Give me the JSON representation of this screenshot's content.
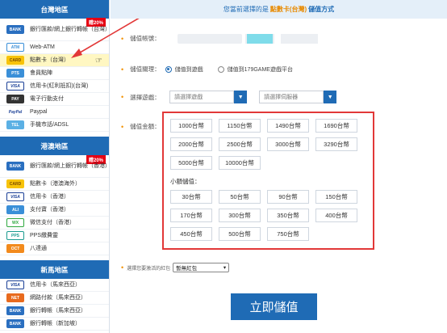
{
  "sidebar": {
    "taiwan": {
      "header": "台灣地區",
      "promo": "贈20%",
      "items": [
        {
          "label": "銀行匯款/網上銀行轉帳（台灣）",
          "icon": "bank-icon",
          "icon_text": "BANK"
        },
        {
          "label": "Web-ATM",
          "icon": "webatm-icon",
          "icon_text": "ATM"
        },
        {
          "label": "點數卡（台灣）",
          "icon": "point-card-icon",
          "icon_text": "CARD"
        },
        {
          "label": "會員點陣",
          "icon": "member-points-icon",
          "icon_text": "PTS"
        },
        {
          "label": "信用卡(紅利抵扣)(台灣)",
          "icon": "visa-icon",
          "icon_text": "VISA"
        },
        {
          "label": "電子行動支付",
          "icon": "mobile-pay-icon",
          "icon_text": "PAY"
        },
        {
          "label": "Paypal",
          "icon": "paypal-icon",
          "icon_text": "PayPal"
        },
        {
          "label": "手機市話/ADSL",
          "icon": "phone-adsl-icon",
          "icon_text": "TEL"
        }
      ]
    },
    "hongkong": {
      "header": "港澳地區",
      "promo": "贈20%",
      "items": [
        {
          "label": "銀行匯款/網上銀行轉帳（香港）",
          "icon": "bank-icon",
          "icon_text": "BANK"
        },
        {
          "label": "點數卡（港澳海外）",
          "icon": "point-card-icon",
          "icon_text": "CARD"
        },
        {
          "label": "信用卡（香港）",
          "icon": "visa-icon",
          "icon_text": "VISA"
        },
        {
          "label": "支付寶（香港）",
          "icon": "alipay-icon",
          "icon_text": "ALI"
        },
        {
          "label": "微信支付（香港）",
          "icon": "wechat-pay-icon",
          "icon_text": "WX"
        },
        {
          "label": "PPS繳費靈",
          "icon": "pps-icon",
          "icon_text": "PPS"
        },
        {
          "label": "八達通",
          "icon": "octopus-icon",
          "icon_text": "OCT"
        }
      ]
    },
    "singapore": {
      "header": "新馬地區",
      "items": [
        {
          "label": "信用卡（馬來西亞）",
          "icon": "visa-icon",
          "icon_text": "VISA"
        },
        {
          "label": "網路付款（馬來西亞）",
          "icon": "online-pay-icon",
          "icon_text": "NET"
        },
        {
          "label": "銀行轉帳（馬來西亞）",
          "icon": "bank-icon",
          "icon_text": "BANK"
        },
        {
          "label": "銀行轉帳（新加坡）",
          "icon": "bank-icon",
          "icon_text": "BANK"
        }
      ]
    }
  },
  "topbar": {
    "prefix": "您當前選擇的是",
    "method": "點數卡(台灣)",
    "suffix": "儲值方式"
  },
  "form": {
    "account_label": "儲值帳號：",
    "target_label": "儲值關理：",
    "target_option1": "儲值到遊戲",
    "target_option2": "儲值到179GAME遊戲平台",
    "game_label": "選擇遊戲：",
    "game_placeholder": "請選擇遊戲",
    "server_placeholder": "請選擇伺服器",
    "amount_label": "儲值金額：",
    "amounts": [
      "1000台幣",
      "1150台幣",
      "1490台幣",
      "1690台幣",
      "2000台幣",
      "2500台幣",
      "3000台幣",
      "3290台幣",
      "5000台幣",
      "10000台幣"
    ],
    "small_title": "小額儲值：",
    "small_amounts": [
      "30台幣",
      "50台幣",
      "90台幣",
      "150台幣",
      "170台幣",
      "300台幣",
      "350台幣",
      "400台幣",
      "450台幣",
      "500台幣",
      "750台幣"
    ],
    "promo_label": "選擇您要激活的紅包",
    "promo_value": "暫無紅包",
    "submit_label": "立即儲值"
  },
  "colors": {
    "primary": "#1f6bb5",
    "accent": "#f29100",
    "highlight": "#e23838",
    "promo_badge": "#e60012"
  }
}
